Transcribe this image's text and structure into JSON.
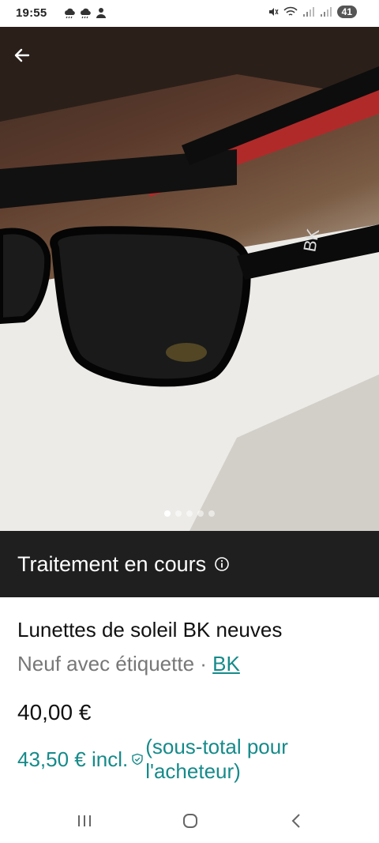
{
  "status_bar": {
    "time": "19:55",
    "battery": "41"
  },
  "listing": {
    "status_banner": "Traitement en cours",
    "title": "Lunettes de soleil BK neuves",
    "condition": "Neuf avec étiquette",
    "separator": " · ",
    "brand": "BK",
    "price": "40,00 €",
    "price_incl": "43,50 € incl.",
    "price_note": "(sous-total pour l'acheteur)"
  },
  "photo": {
    "image_count": 5,
    "current_image": 1
  },
  "colors": {
    "accent": "#168a8a",
    "banner_bg": "#1f1f1f"
  }
}
